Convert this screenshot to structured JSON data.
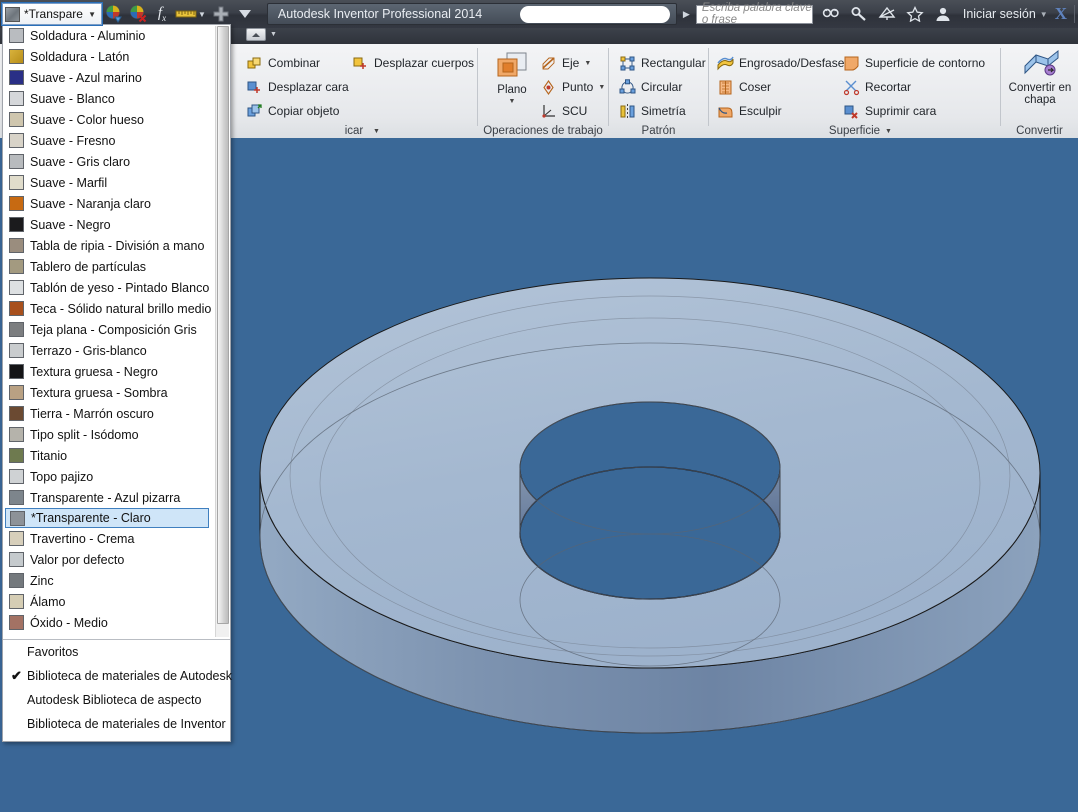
{
  "window": {
    "app_title": "Autodesk Inventor Professional 2014",
    "search_placeholder": "Escriba palabra clave o frase",
    "sign_in_label": "Iniciar sesión",
    "x_logo": "X"
  },
  "quick_access": {
    "material_value": "*Transpare",
    "icons": [
      "appearance-icon",
      "clear-appearance-icon",
      "fx-parameters-icon",
      "measure-icon",
      "add-icon",
      "overflow-caret-icon"
    ],
    "title_icons": [
      "search-icon",
      "help-search-icon",
      "signin-alt-icon",
      "favorites-star-icon",
      "user-icon"
    ]
  },
  "ribbon": {
    "panels": [
      {
        "name": "modificar",
        "label": "icar",
        "commands": [
          {
            "label": "Combinar",
            "icon": "combine-icon"
          },
          {
            "label": "Desplazar cara",
            "icon": "move-face-icon"
          },
          {
            "label": "Copiar objeto",
            "icon": "copy-object-icon"
          },
          {
            "label": "Desplazar cuerpos",
            "icon": "move-bodies-icon"
          }
        ]
      },
      {
        "name": "operaciones-de-trabajo",
        "label": "Operaciones de trabajo",
        "big_command": {
          "label_line1": "Plano",
          "label_line2": "",
          "icon": "work-plane-icon"
        },
        "commands": [
          {
            "label": "Eje",
            "icon": "work-axis-icon",
            "dropdown": true
          },
          {
            "label": "Punto",
            "icon": "work-point-icon",
            "dropdown": true
          },
          {
            "label": "SCU",
            "icon": "ucs-icon",
            "dropdown": false
          }
        ]
      },
      {
        "name": "patron",
        "label": "Patrón",
        "commands": [
          {
            "label": "Rectangular",
            "icon": "rectangular-pattern-icon"
          },
          {
            "label": "Circular",
            "icon": "circular-pattern-icon"
          },
          {
            "label": "Simetría",
            "icon": "mirror-icon"
          }
        ]
      },
      {
        "name": "superficie",
        "label": "Superficie",
        "has_dropdown_caret": true,
        "commands": [
          {
            "label": "Engrosado/Desfase",
            "icon": "thicken-offset-icon"
          },
          {
            "label": "Coser",
            "icon": "stitch-icon"
          },
          {
            "label": "Esculpir",
            "icon": "sculpt-icon"
          },
          {
            "label": "Superficie de contorno",
            "icon": "boundary-patch-icon"
          },
          {
            "label": "Recortar",
            "icon": "trim-icon"
          },
          {
            "label": "Suprimir cara",
            "icon": "delete-face-icon"
          }
        ]
      },
      {
        "name": "convertir",
        "label": "Convertir",
        "big_command": {
          "label_line1": "Convertir en",
          "label_line2": "chapa",
          "icon": "convert-sheet-metal-icon"
        }
      }
    ]
  },
  "material_dropdown": {
    "items": [
      {
        "label": "Soldadura - Aluminio",
        "swatch": "#b9bcc0"
      },
      {
        "label": "Soldadura - Latón",
        "swatch": "#d9b councils"
      },
      {
        "label": "Suave - Azul marino",
        "swatch": "#2a2f86"
      },
      {
        "label": "Suave - Blanco",
        "swatch": "#d5d7da"
      },
      {
        "label": "Suave - Color hueso",
        "swatch": "#cfc6ae"
      },
      {
        "label": "Suave - Fresno",
        "swatch": "#d8d3c8"
      },
      {
        "label": "Suave - Gris claro",
        "swatch": "#b8bbbe"
      },
      {
        "label": "Suave - Marfil",
        "swatch": "#e0dccb"
      },
      {
        "label": "Suave - Naranja claro",
        "swatch": "#c76a12"
      },
      {
        "label": "Suave - Negro",
        "swatch": "#1b1b1d"
      },
      {
        "label": "Tabla de ripia - División a mano",
        "swatch": "#9a8d7e"
      },
      {
        "label": "Tablero de partículas",
        "swatch": "#a39a80"
      },
      {
        "label": "Tablón de yeso - Pintado Blanco",
        "swatch": "#dde0e2"
      },
      {
        "label": "Teca - Sólido natural brillo medio",
        "swatch": "#a8501d"
      },
      {
        "label": "Teja plana - Composición Gris",
        "swatch": "#7c7e80"
      },
      {
        "label": "Terrazo - Gris-blanco",
        "swatch": "#c9ccce"
      },
      {
        "label": "Textura gruesa - Negro",
        "swatch": "#141416"
      },
      {
        "label": "Textura gruesa - Sombra",
        "swatch": "#b9a183"
      },
      {
        "label": "Tierra - Marrón oscuro",
        "swatch": "#6b4a32"
      },
      {
        "label": "Tipo split - Isódomo",
        "swatch": "#b5b3ab"
      },
      {
        "label": "Titanio",
        "swatch": "#6e7a4f"
      },
      {
        "label": "Topo pajizo",
        "swatch": "#cfd2d4"
      },
      {
        "label": "Transparente - Azul pizarra",
        "swatch": "#7d858c"
      },
      {
        "label": "*Transparente - Claro",
        "swatch": "#8d9298",
        "selected": true
      },
      {
        "label": "Travertino - Crema",
        "swatch": "#d7cfbb"
      },
      {
        "label": "Valor por defecto",
        "swatch": "#c5cacd"
      },
      {
        "label": "Zinc",
        "swatch": "#74797d"
      },
      {
        "label": "Álamo",
        "swatch": "#d5cdb4"
      },
      {
        "label": "Óxido - Medio",
        "swatch": "#a37264"
      }
    ],
    "libraries": [
      {
        "label": "Favoritos",
        "checked": false
      },
      {
        "label": "Biblioteca de materiales de Autodesk",
        "checked": true
      },
      {
        "label": "Autodesk Biblioteca de aspecto",
        "checked": false
      },
      {
        "label": "Biblioteca de materiales de Inventor",
        "checked": false
      }
    ]
  },
  "viewport": {
    "name": "3d-model-viewport",
    "background_color": "#3a6897",
    "model": "transparent-annulus-disc",
    "model_top_color": "#a7bad2",
    "model_side_color": "#7e93ad"
  },
  "colors": {
    "accent": "#3f7fbf",
    "selection_bg": "#cfe5f8",
    "viewport_bg": "#3a6897",
    "ribbon_bg": "#e7e9ec",
    "titlebar_bg": "#3b4049"
  }
}
